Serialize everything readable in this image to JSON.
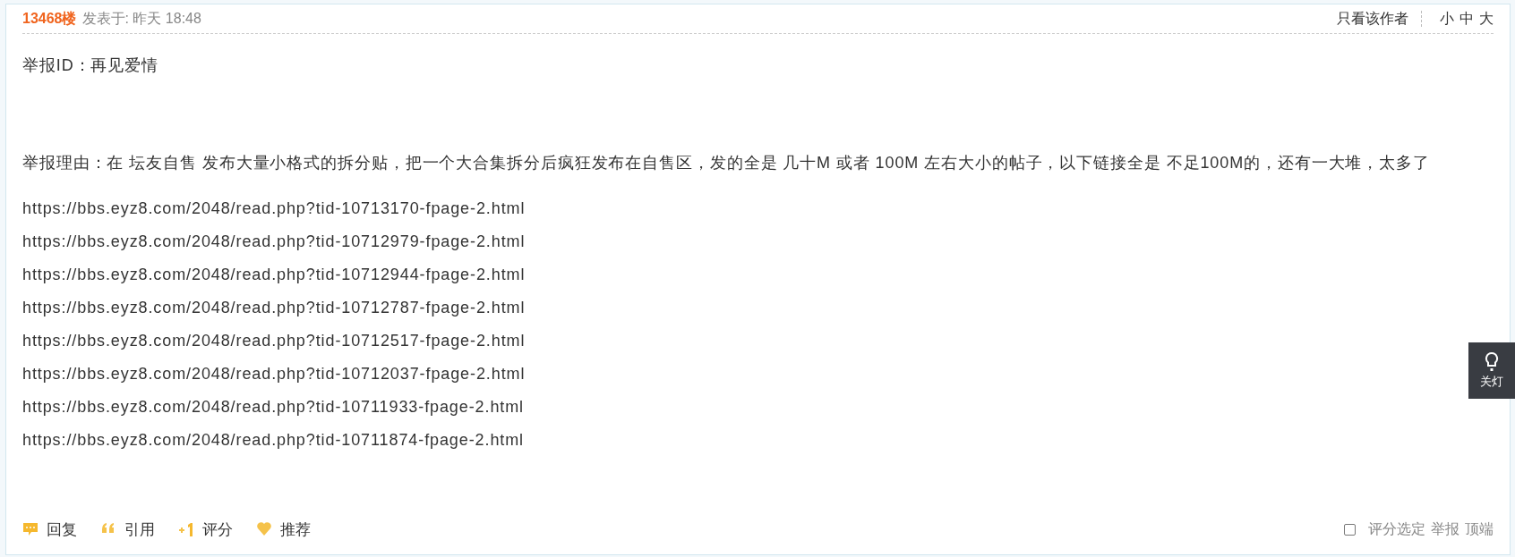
{
  "post": {
    "floor": "13468楼",
    "posted_at": "发表于: 昨天 18:48",
    "author_only": "只看该作者",
    "font_sizes": [
      "小",
      "中",
      "大"
    ]
  },
  "body": {
    "report_id": "举报ID：再见爱情",
    "reason": "举报理由：在 坛友自售 发布大量小格式的拆分贴，把一个大合集拆分后疯狂发布在自售区，发的全是 几十M 或者 100M 左右大小的帖子，以下链接全是 不足100M的，还有一大堆，太多了",
    "links": [
      "https://bbs.eyz8.com/2048/read.php?tid-10713170-fpage-2.html",
      "https://bbs.eyz8.com/2048/read.php?tid-10712979-fpage-2.html",
      "https://bbs.eyz8.com/2048/read.php?tid-10712944-fpage-2.html",
      "https://bbs.eyz8.com/2048/read.php?tid-10712787-fpage-2.html",
      "https://bbs.eyz8.com/2048/read.php?tid-10712517-fpage-2.html",
      "https://bbs.eyz8.com/2048/read.php?tid-10712037-fpage-2.html",
      "https://bbs.eyz8.com/2048/read.php?tid-10711933-fpage-2.html",
      "https://bbs.eyz8.com/2048/read.php?tid-10711874-fpage-2.html"
    ]
  },
  "actions": [
    {
      "kind": "reply",
      "label": "回复"
    },
    {
      "kind": "quote",
      "label": "引用"
    },
    {
      "kind": "rate",
      "label": "评分"
    },
    {
      "kind": "recommend",
      "label": "推荐"
    }
  ],
  "footer": {
    "rate_select": {
      "label": "评分选定",
      "checked": false
    },
    "links": [
      "举报",
      "顶端"
    ]
  },
  "lamp_button": {
    "label": "关灯"
  }
}
